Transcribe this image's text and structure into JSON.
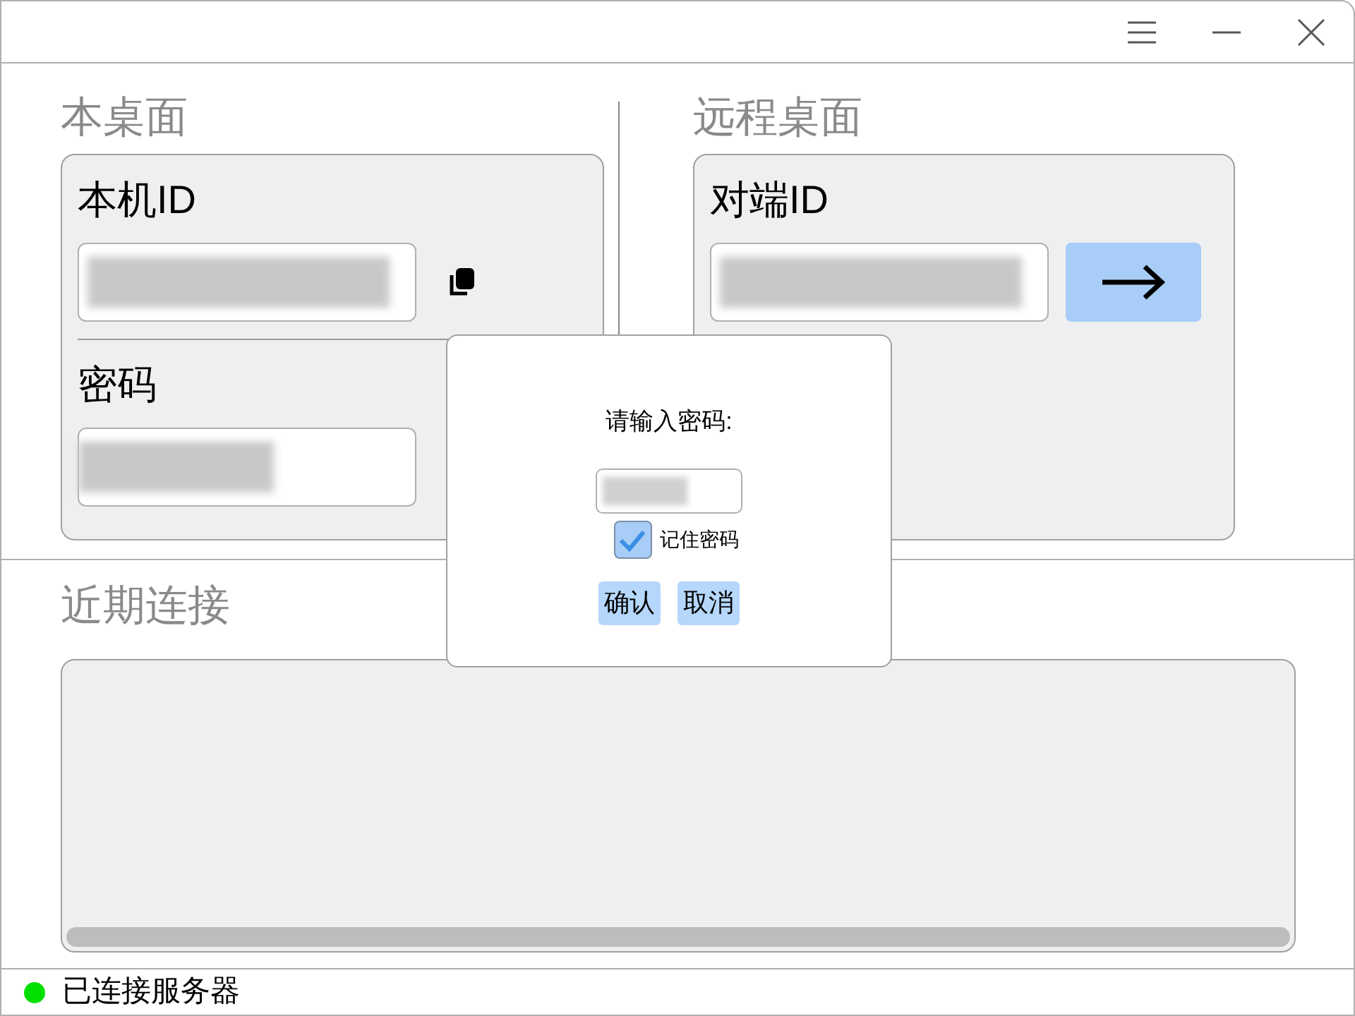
{
  "local": {
    "title": "本桌面",
    "id_label": "本机ID",
    "password_label": "密码"
  },
  "remote": {
    "title": "远程桌面",
    "id_label": "对端ID"
  },
  "recent": {
    "title": "近期连接"
  },
  "dialog": {
    "prompt": "请输入密码:",
    "remember": {
      "label": "记住密码",
      "checked": true
    },
    "buttons": [
      "确认",
      "取消"
    ]
  },
  "status_bar": {
    "text": "已连接服务器",
    "color": "#00e000"
  }
}
